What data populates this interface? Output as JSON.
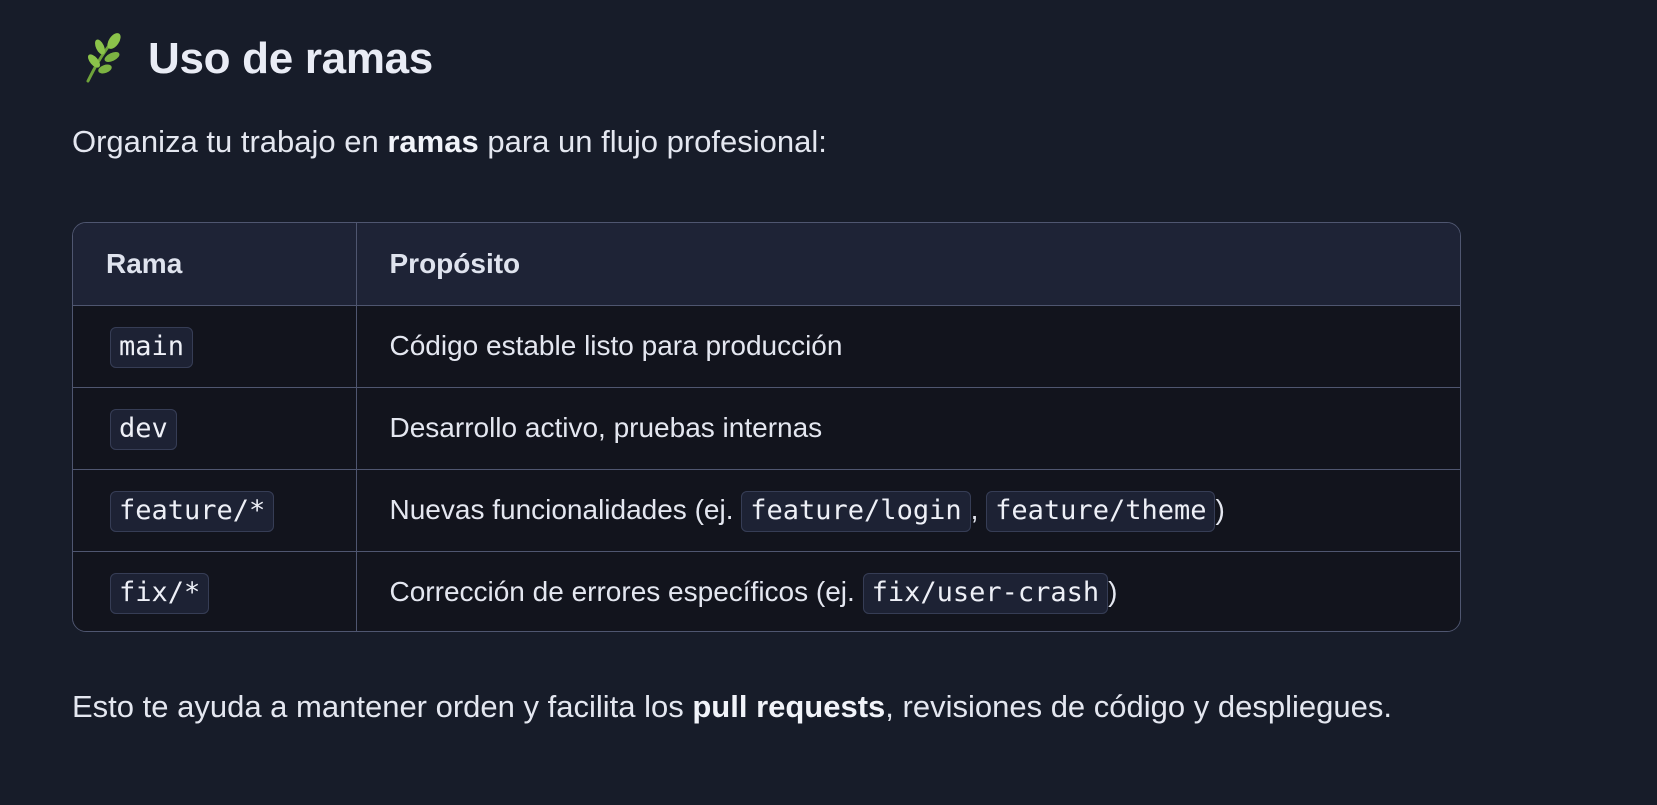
{
  "section": {
    "icon": "herb-leaf-icon",
    "title": "Uso de ramas"
  },
  "intro": {
    "before": "Organiza tu trabajo en ",
    "bold": "ramas",
    "after": " para un flujo profesional:"
  },
  "table": {
    "headers": [
      "Rama",
      "Propósito"
    ],
    "rows": [
      {
        "branch": "main",
        "purpose_text": "Código estable listo para producción"
      },
      {
        "branch": "dev",
        "purpose_text": "Desarrollo activo, pruebas internas"
      },
      {
        "branch": "feature/*",
        "purpose_text": "Nuevas funcionalidades (ej. ",
        "example_1": "feature/login",
        "separator": ", ",
        "example_2": "feature/theme",
        "suffix": ")"
      },
      {
        "branch": "fix/*",
        "purpose_text": "Corrección de errores específicos (ej. ",
        "example_1": "fix/user-crash",
        "suffix": ")"
      }
    ]
  },
  "closing": {
    "before": "Esto te ayuda a mantener orden y facilita los ",
    "bold": "pull requests",
    "after": ", revisiones de código y despliegues."
  },
  "colors": {
    "background": "#171c29",
    "header_row": "#1e2336",
    "body_row": "#12141d",
    "border": "#4f5670",
    "code_bg": "#1d2234",
    "leaf_green": "#8bc34a"
  }
}
